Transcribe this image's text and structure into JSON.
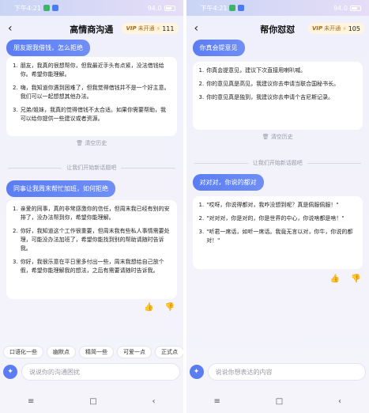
{
  "left": {
    "status": {
      "time": "下午4:21",
      "right": "94.0"
    },
    "header": {
      "back": "‹",
      "title": "高情商沟通",
      "vip_tag": "VIP",
      "vip_status": "未开通",
      "bolt": "⚡",
      "count": "111"
    },
    "q1": "朋友跟我借钱，怎么拒绝",
    "a1": [
      {
        "num": "1.",
        "text": "朋友，我真的很想帮你，但我最近手头有点紧，没法借钱给你。希望你能理解。"
      },
      {
        "num": "2.",
        "text": "嗨，我知道你遇到困难了，但我觉得借钱并不是一个好主意。我们可以一起想想其他办法。"
      },
      {
        "num": "3.",
        "text": "兄弟/姐妹，我真的觉得借钱不太合适。如果你需要帮助，我可以给你提供一些建议或者资源。"
      }
    ],
    "clear": "清空历史",
    "divider": "让我们开始新话题吧",
    "q2": "同事让我周末帮忙加班，如何拒绝",
    "a2": [
      {
        "num": "1.",
        "text": "亲爱的同事，真的非常感激你的信任，但周末我已经有别的安排了，没办法帮到你，希望你能理解。"
      },
      {
        "num": "2.",
        "text": "你好，我知道这个工作很重要，但周末我有些私人事情需要处理，可能没办法加班了，希望你能找到别的帮助请随时告诉我。"
      },
      {
        "num": "3.",
        "text": "你好，我很乐意在平日里多付出一些，周末我想给自己放个假，希望你能理解我的想法，之后有需要请随时告诉我。"
      }
    ],
    "chips": [
      "口语化一些",
      "幽默点",
      "精简一些",
      "可爱一点",
      "正式点"
    ],
    "input_placeholder": "说说你的沟通困扰"
  },
  "right": {
    "status": {
      "time": "下午4:21",
      "right": "94.0"
    },
    "header": {
      "back": "‹",
      "title": "帮你怼怼",
      "vip_tag": "VIP",
      "vip_status": "未开通",
      "bolt": "⚡",
      "count": "105"
    },
    "q1": "你真会提意见",
    "a1": [
      {
        "num": "1.",
        "text": "你真会提意见，建议下次直接用喇叭喊。"
      },
      {
        "num": "2.",
        "text": "你的意见真是高见，我建议你去申请当联合国秘书长。"
      },
      {
        "num": "3.",
        "text": "你的意见真是独到，我建议你去申请个吉尼斯记录。"
      }
    ],
    "clear": "清空历史",
    "divider": "让我们开始新话题吧",
    "q2": "对对对，你说的都对",
    "a2": [
      {
        "num": "1.",
        "text": "\"哎呀，你说得都对，我咋没想到呢？真是佩服佩服！\""
      },
      {
        "num": "2.",
        "text": "\"对对对，你是对的，你是世界的中心，你说啥都是啥！\""
      },
      {
        "num": "3.",
        "text": "\"听君一席话，如听一席话。我竟无言以对，你牛，你说的都对！\""
      }
    ],
    "input_placeholder": "说说你想表达的内容"
  },
  "icons": {
    "thumb_up": "👍",
    "thumb_down": "👎",
    "trash": "🗑",
    "menu": "≡",
    "home": "□",
    "back": "‹"
  }
}
